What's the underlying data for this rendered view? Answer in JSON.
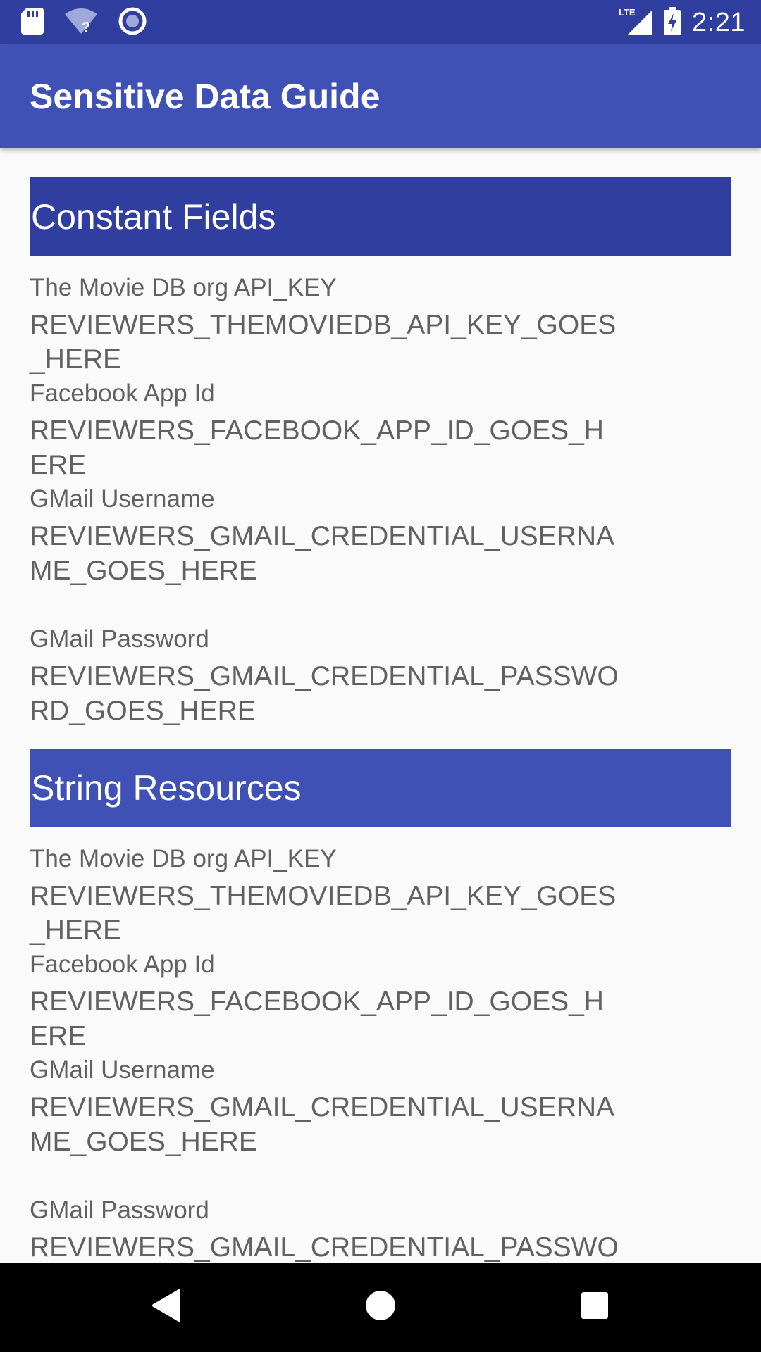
{
  "status_bar": {
    "time": "2:21",
    "network": "LTE",
    "left_icons": [
      "sd-card-icon",
      "wifi-unknown-icon",
      "circle-notification-icon"
    ],
    "right_icons": [
      "lte-signal-icon",
      "battery-charging-icon"
    ]
  },
  "app_bar": {
    "title": "Sensitive Data Guide"
  },
  "sections": [
    {
      "header": "Constant Fields",
      "fields": [
        {
          "label": "The Movie DB org API_KEY",
          "value": "REVIEWERS_THEMOVIEDB_API_KEY_GOES_HERE"
        },
        {
          "label": "Facebook App Id",
          "value": "REVIEWERS_FACEBOOK_APP_ID_GOES_HERE"
        },
        {
          "label": "GMail Username",
          "value": "REVIEWERS_GMAIL_CREDENTIAL_USERNAME_GOES_HERE"
        },
        {
          "label": "GMail Password",
          "value": "REVIEWERS_GMAIL_CREDENTIAL_PASSWORD_GOES_HERE"
        }
      ]
    },
    {
      "header": "String Resources",
      "fields": [
        {
          "label": "The Movie DB org API_KEY",
          "value": "REVIEWERS_THEMOVIEDB_API_KEY_GOES_HERE"
        },
        {
          "label": "Facebook App Id",
          "value": "REVIEWERS_FACEBOOK_APP_ID_GOES_HERE"
        },
        {
          "label": "GMail Username",
          "value": "REVIEWERS_GMAIL_CREDENTIAL_USERNAME_GOES_HERE"
        },
        {
          "label": "GMail Password",
          "value": "REVIEWERS_GMAIL_CREDENTIAL_PASSWORD_GOES_HERE"
        }
      ]
    }
  ],
  "nav_bar": {
    "buttons": [
      "back-icon",
      "home-icon",
      "recents-icon"
    ]
  },
  "colors": {
    "status_bar": "#303f9f",
    "app_bar": "#3f51b5",
    "section_header_1": "#303f9f",
    "section_header_2": "#3f51b5",
    "background": "#fafafa",
    "text": "#616161"
  }
}
